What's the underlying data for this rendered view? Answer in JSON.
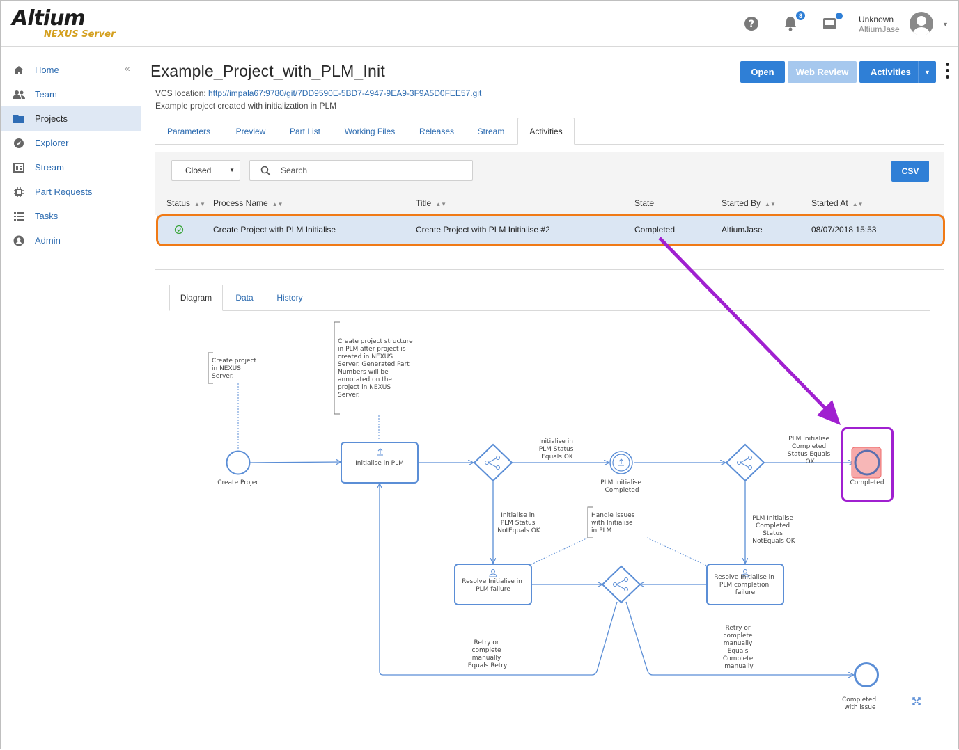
{
  "header": {
    "logo_main": "Altium",
    "logo_sub": "NEXUS Server",
    "notification_count": "8",
    "user_name": "Unknown",
    "user_login": "AltiumJase"
  },
  "sidebar": {
    "items": [
      {
        "label": "Home",
        "icon": "home-icon"
      },
      {
        "label": "Team",
        "icon": "team-icon"
      },
      {
        "label": "Projects",
        "icon": "folder-icon"
      },
      {
        "label": "Explorer",
        "icon": "compass-icon"
      },
      {
        "label": "Stream",
        "icon": "stream-icon"
      },
      {
        "label": "Part Requests",
        "icon": "chip-icon"
      },
      {
        "label": "Tasks",
        "icon": "tasks-icon"
      },
      {
        "label": "Admin",
        "icon": "user-icon"
      }
    ],
    "active_index": 2
  },
  "project": {
    "title": "Example_Project_with_PLM_Init",
    "vcs_label": "VCS location: ",
    "vcs_url": "http://impala67:9780/git/7DD9590E-5BD7-4947-9EA9-3F9A5D0FEE57.git",
    "description": "Example project created with initialization in PLM"
  },
  "actions": {
    "open": "Open",
    "web_review": "Web Review",
    "activities": "Activities"
  },
  "tabs": [
    "Parameters",
    "Preview",
    "Part List",
    "Working Files",
    "Releases",
    "Stream",
    "Activities"
  ],
  "active_tab": "Activities",
  "filter": {
    "status_value": "Closed",
    "search_placeholder": "Search",
    "csv_label": "CSV"
  },
  "table": {
    "columns": [
      "Status",
      "Process Name",
      "Title",
      "State",
      "Started By",
      "Started At"
    ],
    "rows": [
      {
        "status": "completed",
        "process_name": "Create Project with PLM Initialise",
        "title": "Create Project with PLM Initialise #2",
        "state": "Completed",
        "started_by": "AltiumJase",
        "started_at": "08/07/2018 15:53"
      }
    ]
  },
  "subtabs": [
    "Diagram",
    "Data",
    "History"
  ],
  "active_subtab": "Diagram",
  "diagram": {
    "annotations": {
      "create_note": [
        "Create project",
        "in NEXUS",
        "Server."
      ],
      "structure_note": [
        "Create project structure",
        "in PLM after project is",
        "created in NEXUS",
        "Server. Generated Part",
        "Numbers will be",
        "annotated on the",
        "project in NEXUS",
        "Server."
      ],
      "handle_note": [
        "Handle issues",
        "with Initialise",
        "in PLM"
      ]
    },
    "nodes": {
      "start": "Create Project",
      "init_task": "Initialise in PLM",
      "plm_completed": [
        "PLM Initialise",
        "Completed"
      ],
      "end_completed": "Completed",
      "resolve_init": [
        "Resolve Initialise in",
        "PLM failure"
      ],
      "resolve_completion": [
        "Resolve Initialise in",
        "PLM completion",
        "failure"
      ],
      "end_issue": [
        "Completed",
        "with issue"
      ]
    },
    "edges": {
      "status_ok": [
        "Initialise in",
        "PLM Status",
        "Equals OK"
      ],
      "status_not_ok": [
        "Initialise in",
        "PLM Status",
        "NotEquals OK"
      ],
      "completed_ok": [
        "PLM Initialise",
        "Completed",
        "Status Equals",
        "OK"
      ],
      "completed_not_ok": [
        "PLM Initialise",
        "Completed",
        "Status",
        "NotEquals OK"
      ],
      "retry": [
        "Retry or",
        "complete",
        "manually",
        "Equals Retry"
      ],
      "complete_manually": [
        "Retry or",
        "complete",
        "manually",
        "Equals",
        "Complete",
        "manually"
      ]
    }
  },
  "colors": {
    "accent": "#2f7fd6",
    "row_highlight": "#f07a16",
    "node_highlight": "#a020d0",
    "diagram_stroke": "#5b8ed6"
  }
}
